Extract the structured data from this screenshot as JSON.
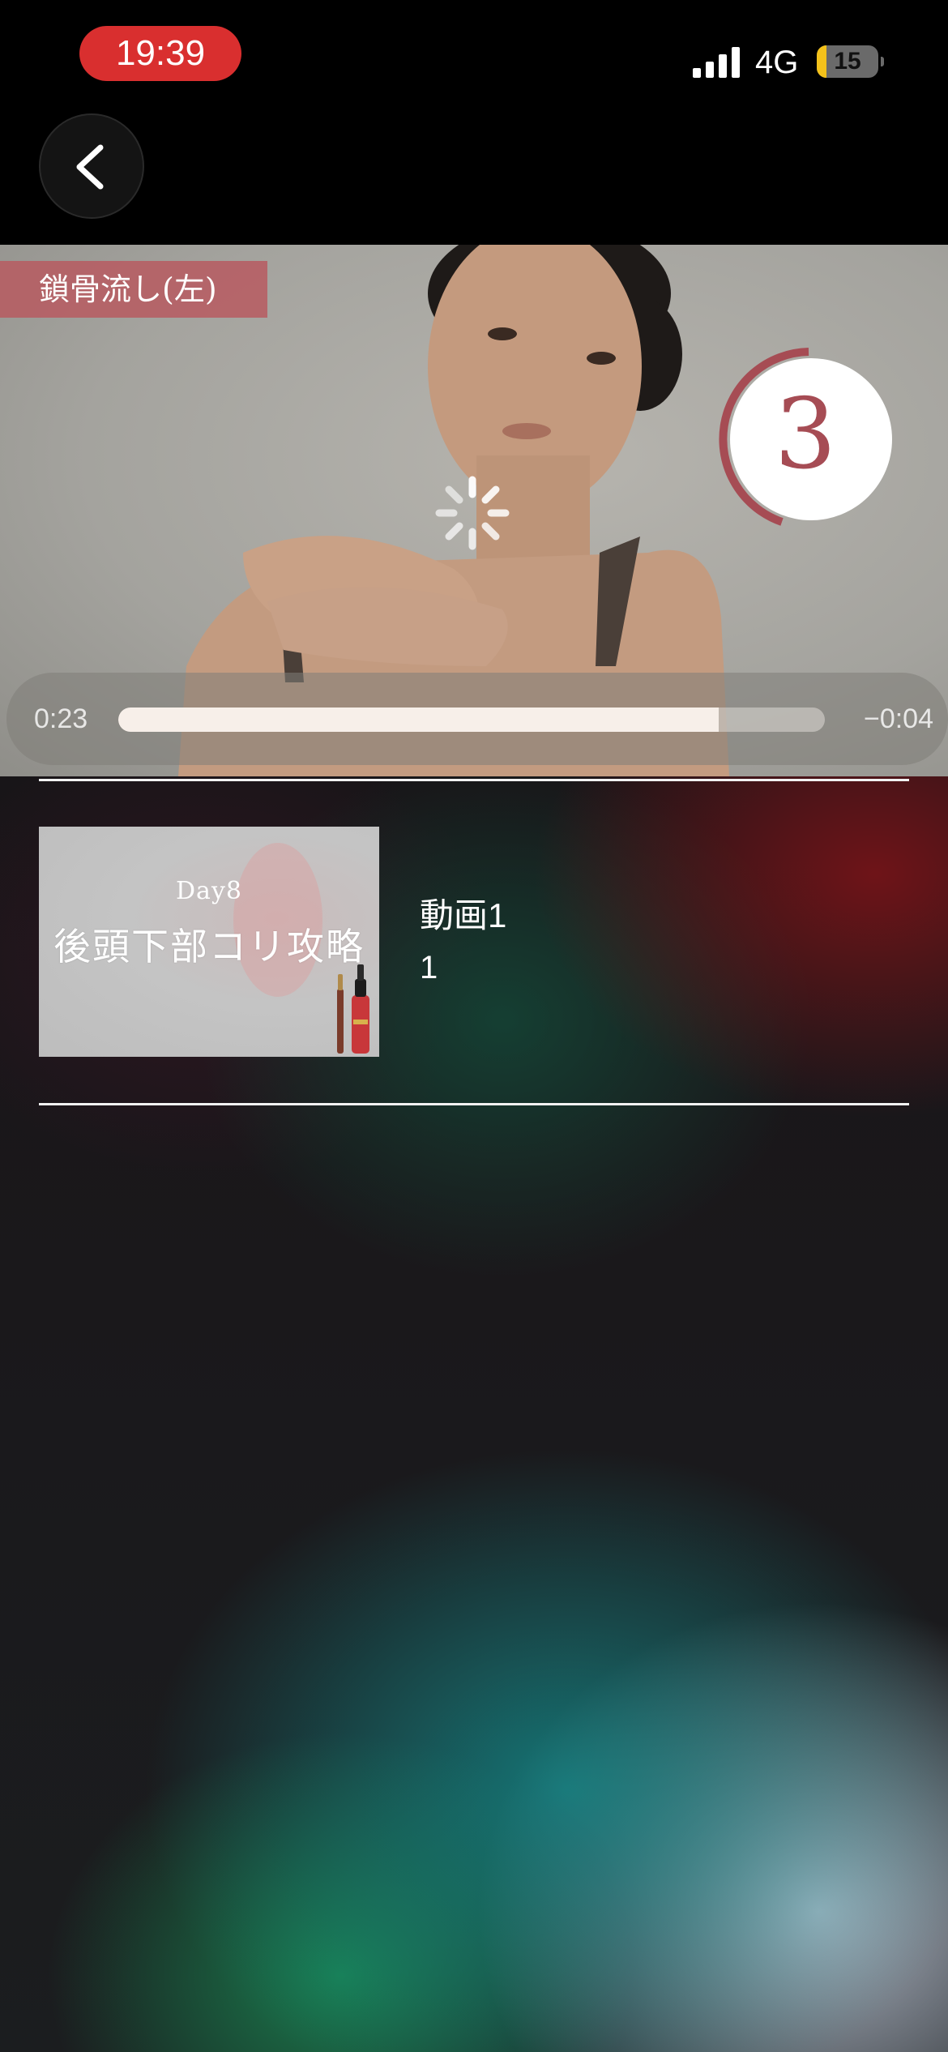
{
  "status_bar": {
    "time": "19:39",
    "network": "4G",
    "battery": "15",
    "icons": [
      "signal-icon",
      "battery-icon"
    ]
  },
  "header": {
    "back_icon": "chevron-left-icon"
  },
  "player": {
    "exercise_label": "鎖骨流し(左)",
    "countdown": "3",
    "elapsed": "0:23",
    "remaining": "−0:04",
    "progress": 0.85,
    "spinner_icon": "loading-spinner-icon",
    "colors": {
      "label_bg": "#b75a60",
      "countdown_ring": "#a64c54"
    }
  },
  "playlist": {
    "items": [
      {
        "thumbnail_day": "Day8",
        "thumbnail_title": "後頭下部コリ攻略",
        "title": "動画1",
        "subtitle": "1"
      }
    ]
  }
}
